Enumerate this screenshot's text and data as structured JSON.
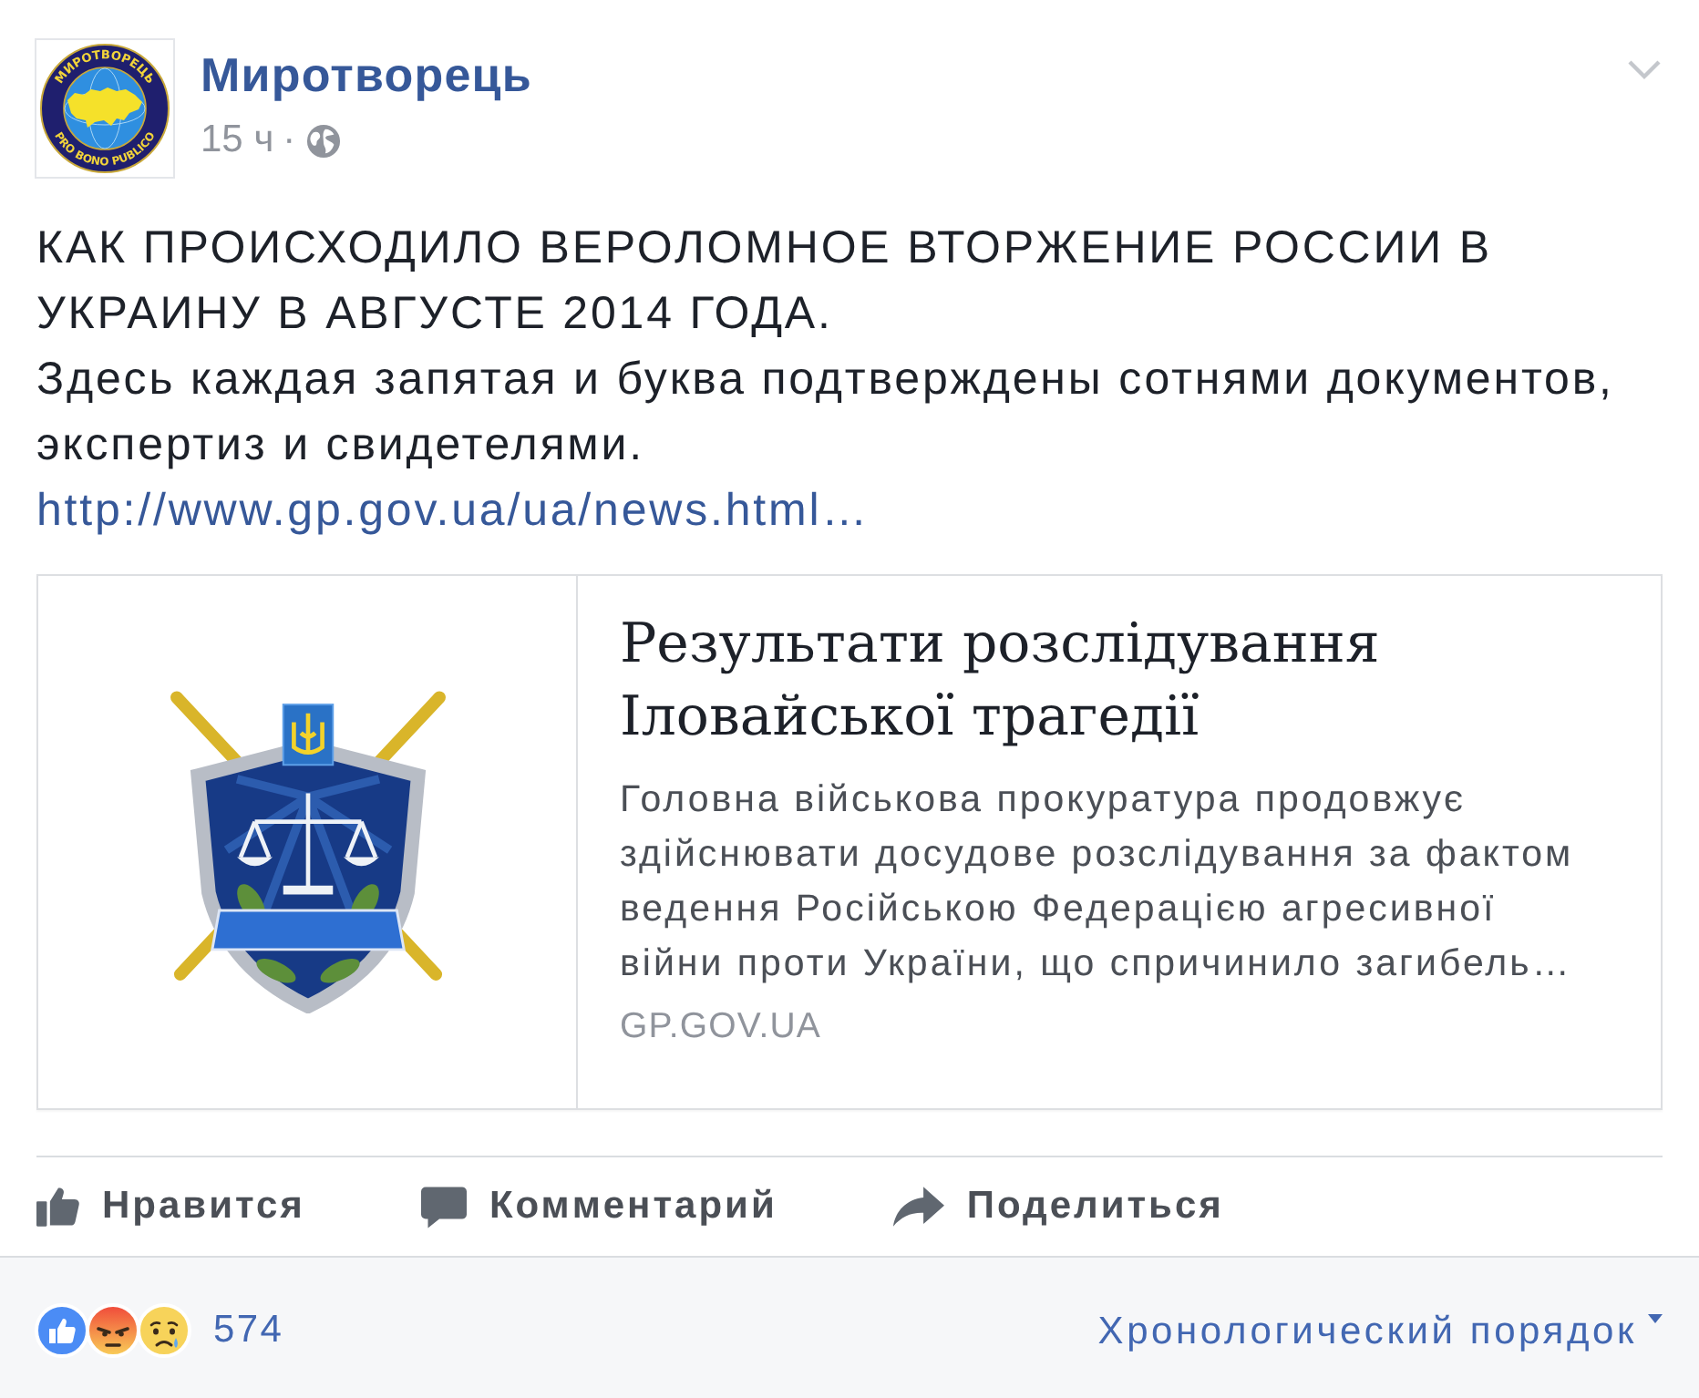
{
  "post": {
    "author": "Миротворець",
    "avatar": {
      "top_text": "МИРОТВОРЕЦЬ",
      "bottom_text": "PRO BONO PUBLICO"
    },
    "time": "15 ч",
    "separator": "·",
    "paragraphs": [
      "КАК ПРОИСХОДИЛО ВЕРОЛОМНОЕ ВТОРЖЕНИЕ РОССИИ В УКРАИНУ В АВГУСТЕ 2014 ГОДА.",
      "Здесь каждая запятая и буква подтверждены сотнями документов, экспертиз и свидетелями."
    ],
    "link": "http://www.gp.gov.ua/ua/news.html…"
  },
  "link_preview": {
    "title": "Результати розслідування Іловайської трагедії",
    "description": "Головна військова прокуратура продовжує здійснювати досудове розслідування за фактом ведення Російською Федерацією агресивної війни проти України, що спричинило загибель…",
    "domain": "GP.GOV.UA"
  },
  "actions": [
    {
      "kind": "like",
      "label": "Нравится"
    },
    {
      "kind": "comment",
      "label": "Комментарий"
    },
    {
      "kind": "share",
      "label": "Поделиться"
    }
  ],
  "reactions": {
    "icons": [
      {
        "kind": "like"
      },
      {
        "kind": "angry"
      },
      {
        "kind": "sad"
      }
    ],
    "count": "574"
  },
  "sort": {
    "label": "Хронологический порядок"
  }
}
